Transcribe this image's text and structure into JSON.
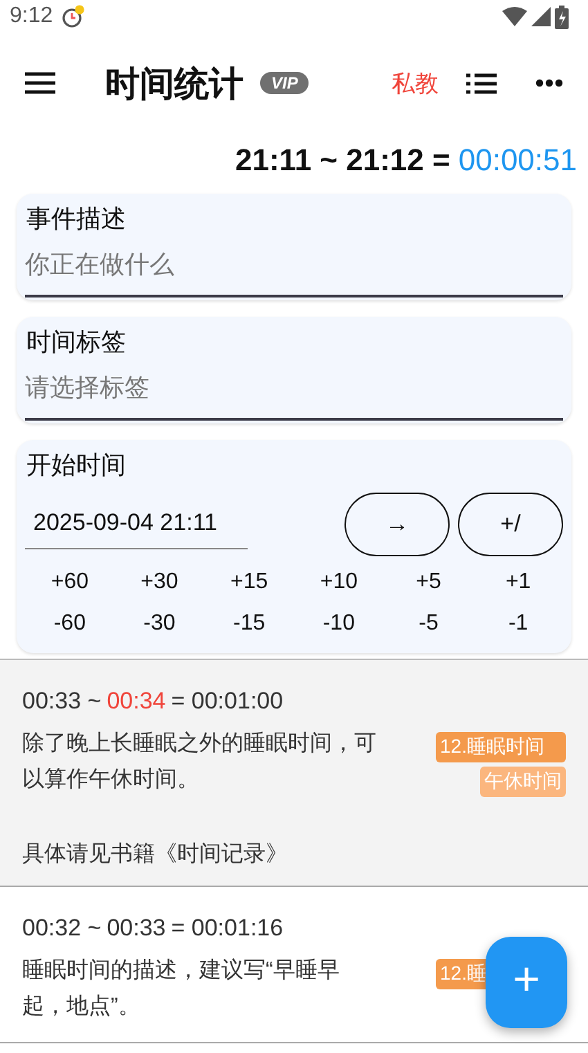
{
  "status_bar": {
    "time": "9:12"
  },
  "app_bar": {
    "title": "时间统计",
    "badge": "VIP",
    "coach": "私教"
  },
  "summary": {
    "range": "21:11 ~ 21:12 =",
    "duration": "00:00:51"
  },
  "fields": [
    {
      "label": "事件描述",
      "placeholder": "你正在做什么"
    },
    {
      "label": "时间标签",
      "placeholder": "请选择标签"
    }
  ],
  "start_time": {
    "label": "开始时间",
    "value": "2025-09-04 21:11",
    "buttons": [
      "→",
      "+/"
    ],
    "adjustments": [
      "+60",
      "+30",
      "+15",
      "+10",
      "+5",
      "+1",
      "-60",
      "-30",
      "-15",
      "-10",
      "-5",
      "-1"
    ]
  },
  "records": [
    {
      "start": "00:33 ~",
      "end": "00:34",
      "rest": "= 00:01:00",
      "end_highlighted": true,
      "shaded": true,
      "description": "除了晚上长睡眠之外的睡眠时间，可以算作午休时间。",
      "note": "具体请见书籍《时间记录》",
      "tags": [
        {
          "label": "12.睡眠时间",
          "color": "#f49a4c"
        },
        {
          "label": "午休时间",
          "color": "#fbb67e"
        }
      ]
    },
    {
      "start": "00:32 ~",
      "end": "00:33",
      "rest": "= 00:01:16",
      "end_highlighted": false,
      "shaded": false,
      "description": "睡眠时间的描述，建议写“早睡早起，地点”。",
      "tags": [
        {
          "label": "12.睡",
          "color": "#f49a4c"
        }
      ]
    }
  ],
  "fab": {
    "label": "+"
  }
}
